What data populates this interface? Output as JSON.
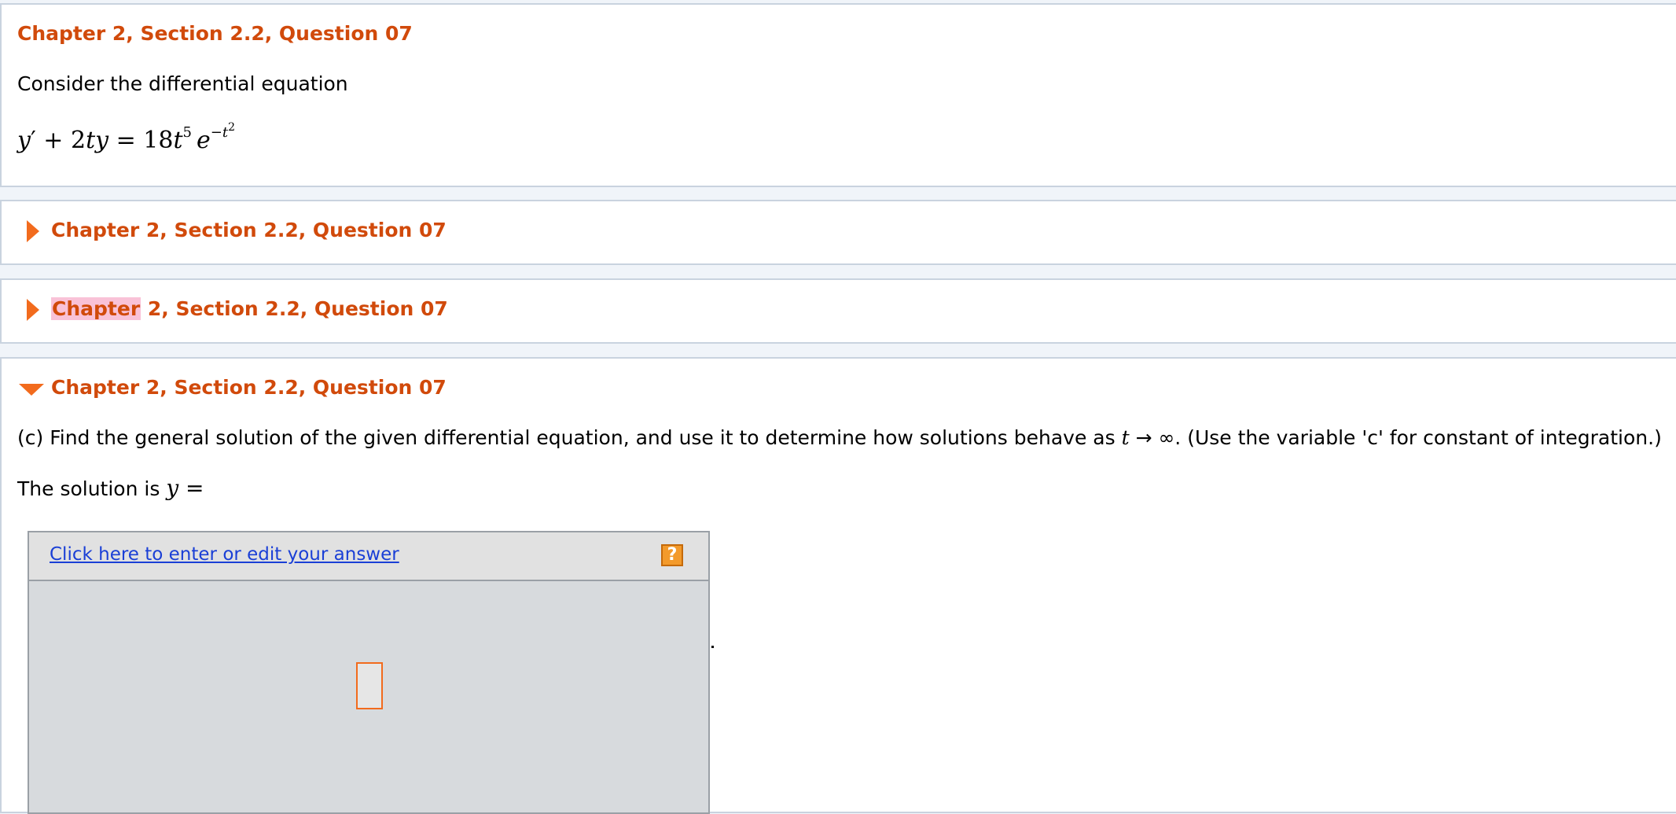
{
  "panels": [
    {
      "heading": "Chapter 2, Section 2.2, Question 07",
      "intro": "Consider the differential equation",
      "equation": {
        "lhs_y": "y",
        "prime": "′",
        "plus": " + 2",
        "ty": "ty",
        "equals": " = 18",
        "t": "t",
        "t_exp": "5",
        "e": "e",
        "e_exp_prefix": "−",
        "e_exp_t": "t",
        "e_exp_pow": "2"
      }
    },
    {
      "heading": "Chapter 2, Section 2.2, Question 07",
      "collapsed": true
    },
    {
      "heading_highlighted_word": "Chapter",
      "heading_rest": " 2, Section 2.2, Question 07",
      "collapsed": true
    },
    {
      "heading": "Chapter 2, Section 2.2, Question 07",
      "expanded": true,
      "question_text_before": "(c) Find the general solution of the given differential equation, and use it to determine how solutions behave as ",
      "question_var_t": "t",
      "question_arrow": " → ∞",
      "question_text_after": ". (Use the variable 'c' for constant of integration.)",
      "solution_prefix": "The solution is ",
      "solution_var": "y",
      "solution_equals": " =",
      "answer_link": "Click here to enter or edit your answer",
      "help_label": "?",
      "trailing_punct": "."
    }
  ],
  "colors": {
    "heading": "#d14a0b",
    "triangle": "#f26b1d",
    "highlight": "#f9c2d7",
    "link": "#1a3fd6",
    "help": "#f39a2b"
  },
  "icons": {
    "collapsed": "triangle-right-icon",
    "expanded": "triangle-down-icon",
    "help": "help-question-icon"
  }
}
